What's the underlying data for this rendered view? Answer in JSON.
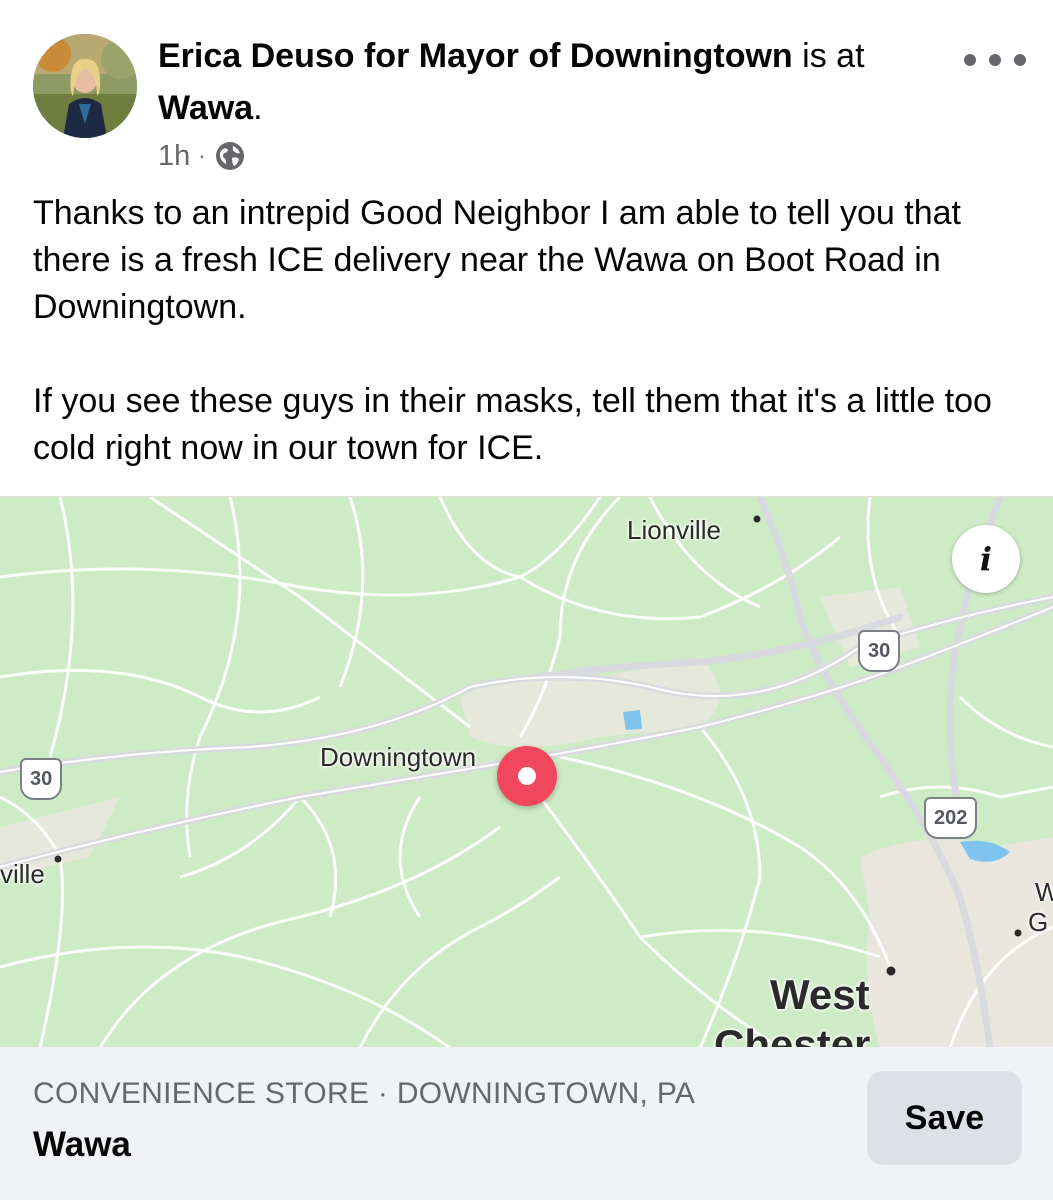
{
  "post": {
    "author": "Erica Deuso for Mayor of Downingtown",
    "connector": "is at",
    "location": "Wawa",
    "period": ".",
    "time": "1h",
    "separator": "·",
    "privacy_icon": "globe-icon",
    "body_paragraph_1": "Thanks to an intrepid Good Neighbor I am able to tell you that there is a fresh ICE delivery near the Wawa on Boot Road in Downingtown.",
    "body_paragraph_2": "If you see these guys in their masks, tell them that it's a little too cold right now in our town for ICE."
  },
  "map": {
    "labels": {
      "lionville": "Lionville",
      "downingtown": "Downingtown",
      "ville": "ville",
      "west": "West",
      "chester": "Chester",
      "w": "W",
      "g": "G"
    },
    "shields": {
      "route30_a": "30",
      "route30_b": "30",
      "route202": "202"
    },
    "info_icon": "i",
    "colors": {
      "land": "#cdebc4",
      "road": "#ffffff",
      "highway": "#d9dadf",
      "urban": "#e9e6dd",
      "water": "#7fc4ee",
      "pin": "#f0475c"
    }
  },
  "place": {
    "category": "CONVENIENCE STORE · DOWNINGTOWN, PA",
    "name": "Wawa",
    "save_label": "Save"
  }
}
